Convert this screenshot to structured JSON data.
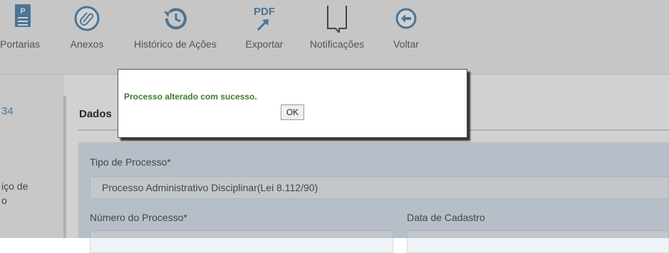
{
  "toolbar": {
    "items": [
      {
        "label": "Portarias",
        "icon": "document-p-icon"
      },
      {
        "label": "Anexos",
        "icon": "paperclip-icon"
      },
      {
        "label": "Histórico de Ações",
        "icon": "history-icon"
      },
      {
        "label": "Exportar",
        "icon": "pdf-export-icon"
      },
      {
        "label": "Notificações",
        "icon": "notification-icon"
      },
      {
        "label": "Voltar",
        "icon": "back-arrow-icon"
      }
    ],
    "pdf_text": "PDF",
    "p_text": "P"
  },
  "left": {
    "number": "34",
    "text_line1": "iço de",
    "text_line2": "o"
  },
  "tab": {
    "title": "Dados"
  },
  "form": {
    "tipo_label": "Tipo de Processo*",
    "tipo_value": "Processo Administrativo Disciplinar(Lei 8.112/90)",
    "numero_label": "Número do Processo*",
    "data_label": "Data de Cadastro"
  },
  "dialog": {
    "message": "Processo alterado com sucesso.",
    "ok_label": "OK"
  },
  "colors": {
    "message_green": "#3a7d2b",
    "icon_blue": "#5b8fb9"
  }
}
